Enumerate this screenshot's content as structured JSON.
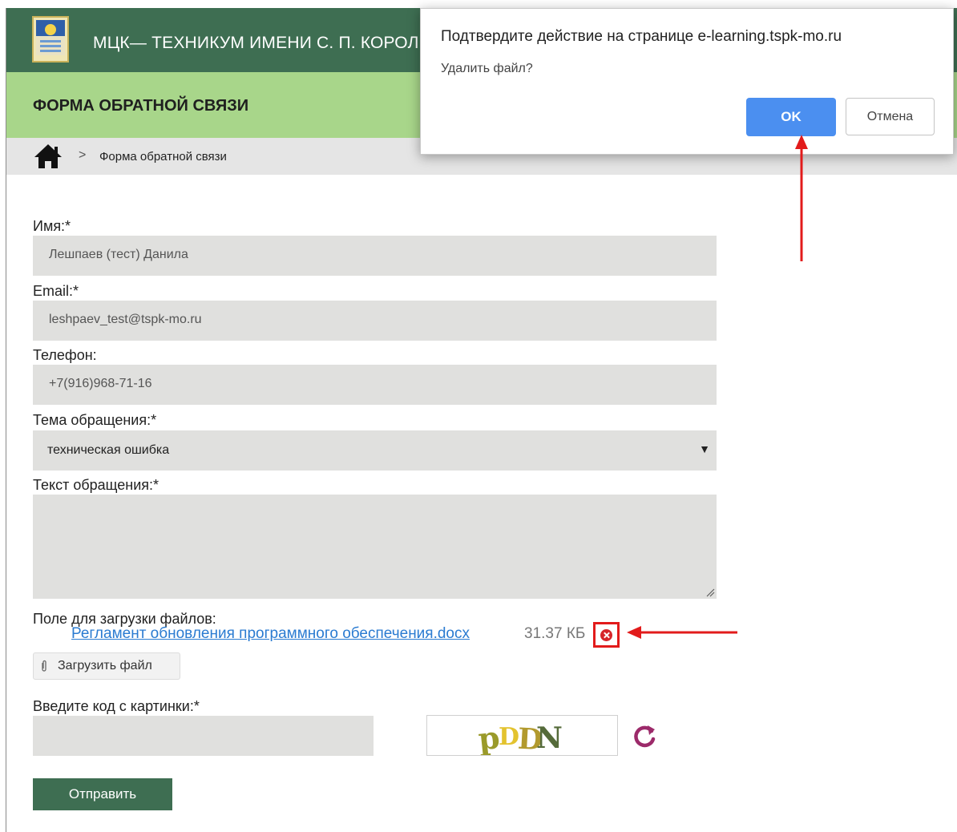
{
  "header": {
    "site_title": "МЦК— ТЕХНИКУМ ИМЕНИ С. П. КОРОЛЁВА",
    "logo_icon": "college-emblem-icon"
  },
  "subheader": {
    "title": "ФОРМА ОБРАТНОЙ СВЯЗИ"
  },
  "breadcrumb": {
    "home_icon": "home-icon",
    "separator": ">",
    "current": "Форма обратной связи"
  },
  "form": {
    "name": {
      "label": "Имя:*",
      "value": "Лешпаев (тест) Данила"
    },
    "email": {
      "label": "Email:*",
      "value": "leshpaev_test@tspk-mo.ru"
    },
    "phone": {
      "label": "Телефон:",
      "value": "+7(916)968-71-16"
    },
    "topic": {
      "label": "Тема обращения:*",
      "value": "техническая ошибка"
    },
    "message": {
      "label": "Текст обращения:*",
      "value": ""
    },
    "files": {
      "label": "Поле для загрузки файлов:",
      "file_name": "Регламент обновления программного обеспечения.docx",
      "file_size": "31.37 КБ",
      "upload_label": "Загрузить файл"
    },
    "captcha": {
      "label": "Введите код с картинки:*",
      "code_text": "pDDN"
    },
    "submit_label": "Отправить"
  },
  "dialog": {
    "title": "Подтвердите действие на странице e-learning.tspk-mo.ru",
    "message": "Удалить файл?",
    "ok_label": "OK",
    "cancel_label": "Отмена"
  },
  "colors": {
    "header_green": "#3e6e52",
    "subheader_green": "#a8d68a",
    "ok_blue": "#4b8ff0",
    "annotation_red": "#e21b1b"
  }
}
